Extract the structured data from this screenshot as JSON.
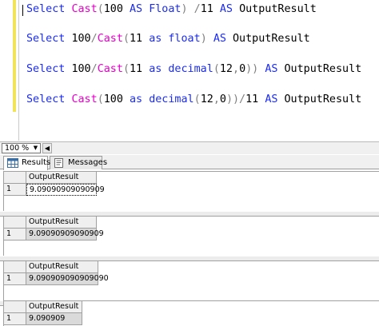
{
  "editor": {
    "lines": [
      {
        "tokens": [
          {
            "t": "Select ",
            "c": "kw"
          },
          {
            "t": "Cast",
            "c": "fn"
          },
          {
            "t": "(",
            "c": "op"
          },
          {
            "t": "100 ",
            "c": "tx"
          },
          {
            "t": "AS ",
            "c": "kw"
          },
          {
            "t": "Float",
            "c": "kw"
          },
          {
            "t": ") /",
            "c": "op"
          },
          {
            "t": "11 ",
            "c": "tx"
          },
          {
            "t": "AS ",
            "c": "kw"
          },
          {
            "t": "OutputResult",
            "c": "tx"
          }
        ]
      },
      {
        "tokens": [
          {
            "t": "Select ",
            "c": "kw"
          },
          {
            "t": "100",
            "c": "tx"
          },
          {
            "t": "/",
            "c": "op"
          },
          {
            "t": "Cast",
            "c": "fn"
          },
          {
            "t": "(",
            "c": "op"
          },
          {
            "t": "11 ",
            "c": "tx"
          },
          {
            "t": "as ",
            "c": "kw"
          },
          {
            "t": "float",
            "c": "kw"
          },
          {
            "t": ") ",
            "c": "op"
          },
          {
            "t": "AS ",
            "c": "kw"
          },
          {
            "t": "OutputResult",
            "c": "tx"
          }
        ]
      },
      {
        "tokens": [
          {
            "t": "Select ",
            "c": "kw"
          },
          {
            "t": "100",
            "c": "tx"
          },
          {
            "t": "/",
            "c": "op"
          },
          {
            "t": "Cast",
            "c": "fn"
          },
          {
            "t": "(",
            "c": "op"
          },
          {
            "t": "11 ",
            "c": "tx"
          },
          {
            "t": "as ",
            "c": "kw"
          },
          {
            "t": "decimal",
            "c": "kw"
          },
          {
            "t": "(",
            "c": "op"
          },
          {
            "t": "12",
            "c": "tx"
          },
          {
            "t": ",",
            "c": "op"
          },
          {
            "t": "0",
            "c": "tx"
          },
          {
            "t": ")) ",
            "c": "op"
          },
          {
            "t": "AS ",
            "c": "kw"
          },
          {
            "t": "OutputResult",
            "c": "tx"
          }
        ]
      },
      {
        "tokens": [
          {
            "t": "Select ",
            "c": "kw"
          },
          {
            "t": "Cast",
            "c": "fn"
          },
          {
            "t": "(",
            "c": "op"
          },
          {
            "t": "100 ",
            "c": "tx"
          },
          {
            "t": "as ",
            "c": "kw"
          },
          {
            "t": "decimal",
            "c": "kw"
          },
          {
            "t": "(",
            "c": "op"
          },
          {
            "t": "12",
            "c": "tx"
          },
          {
            "t": ",",
            "c": "op"
          },
          {
            "t": "0",
            "c": "tx"
          },
          {
            "t": "))/",
            "c": "op"
          },
          {
            "t": "11 ",
            "c": "tx"
          },
          {
            "t": "AS ",
            "c": "kw"
          },
          {
            "t": "OutputResult",
            "c": "tx"
          }
        ]
      }
    ]
  },
  "statusbar": {
    "zoom": "100 %",
    "zoom_arrow_icon": "chevron-down-icon",
    "scroll_left_icon": "chevron-left-icon"
  },
  "tabs": [
    {
      "label": "Results",
      "icon": "grid-icon",
      "active": true
    },
    {
      "label": "Messages",
      "icon": "message-icon",
      "active": false
    }
  ],
  "result_grids": [
    {
      "column": "OutputResult",
      "rows": [
        {
          "num": "1",
          "value": "9.09090909090909"
        }
      ],
      "selected": true
    },
    {
      "column": "OutputResult",
      "rows": [
        {
          "num": "1",
          "value": "9.09090909090909"
        }
      ],
      "selected": false
    },
    {
      "column": "OutputResult",
      "rows": [
        {
          "num": "1",
          "value": "9.090909090909090"
        }
      ],
      "selected": false
    },
    {
      "column": "OutputResult",
      "rows": [
        {
          "num": "1",
          "value": "9.090909"
        }
      ],
      "selected": false
    }
  ],
  "colors": {
    "keyword": "#1b2cf0",
    "function": "#e400c8",
    "operator": "#808080",
    "change_bar": "#f2e45a"
  }
}
